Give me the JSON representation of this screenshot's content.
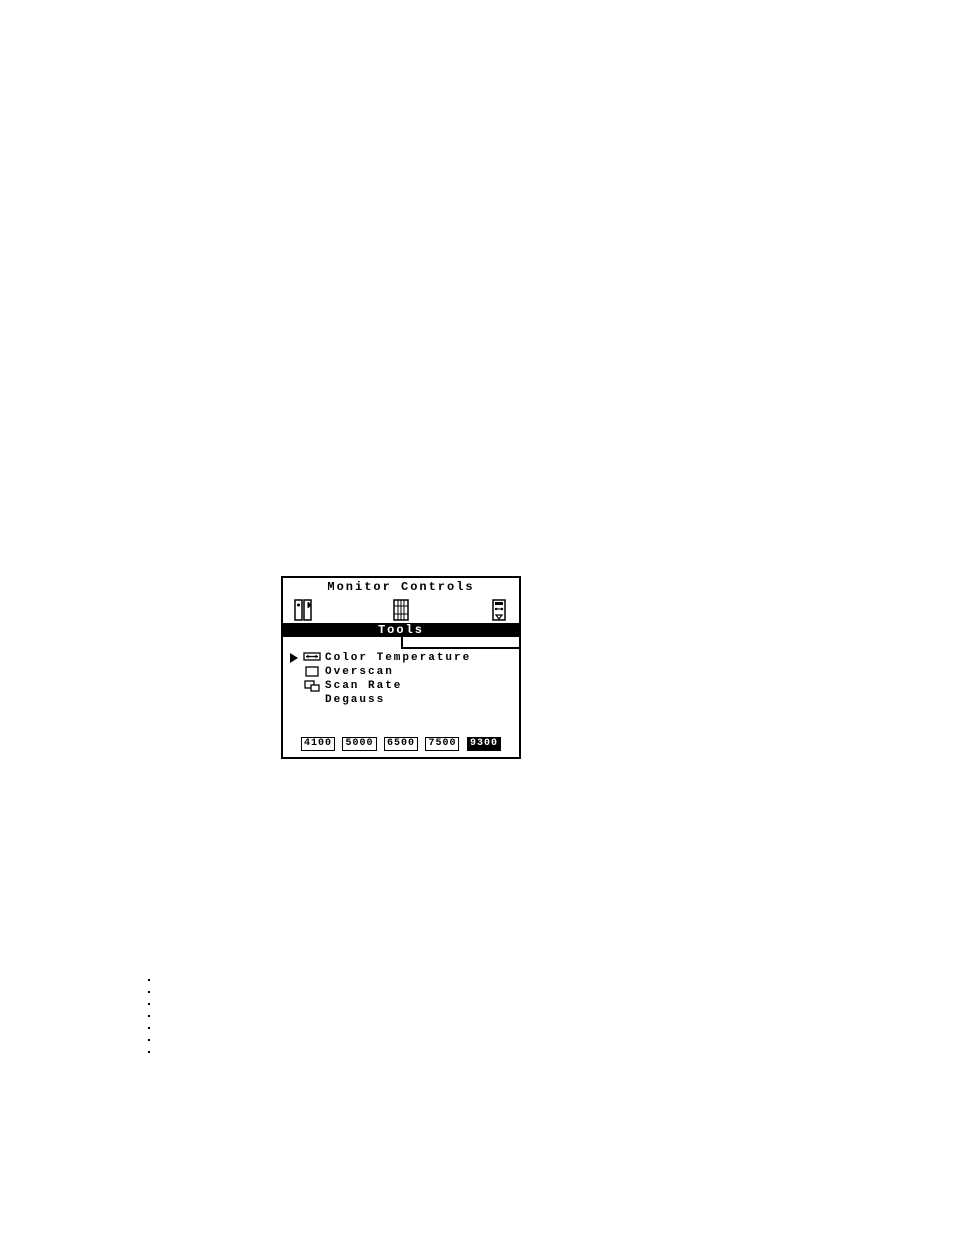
{
  "osd": {
    "title": "Monitor Controls",
    "subtitle": "Tools",
    "tabs": [
      {
        "name": "brightness-contrast-tab"
      },
      {
        "name": "geometry-tab"
      },
      {
        "name": "tools-tab"
      }
    ],
    "menu": [
      {
        "label": "Color Temperature",
        "selected": true,
        "icon": "color-temp-icon"
      },
      {
        "label": "Overscan",
        "selected": false,
        "icon": "overscan-icon"
      },
      {
        "label": "Scan Rate",
        "selected": false,
        "icon": "scan-rate-icon"
      },
      {
        "label": "Degauss",
        "selected": false,
        "icon": null
      }
    ],
    "options": [
      {
        "value": "4100",
        "selected": false
      },
      {
        "value": "5000",
        "selected": false
      },
      {
        "value": "6500",
        "selected": false
      },
      {
        "value": "7500",
        "selected": false
      },
      {
        "value": "9300",
        "selected": true
      }
    ]
  }
}
